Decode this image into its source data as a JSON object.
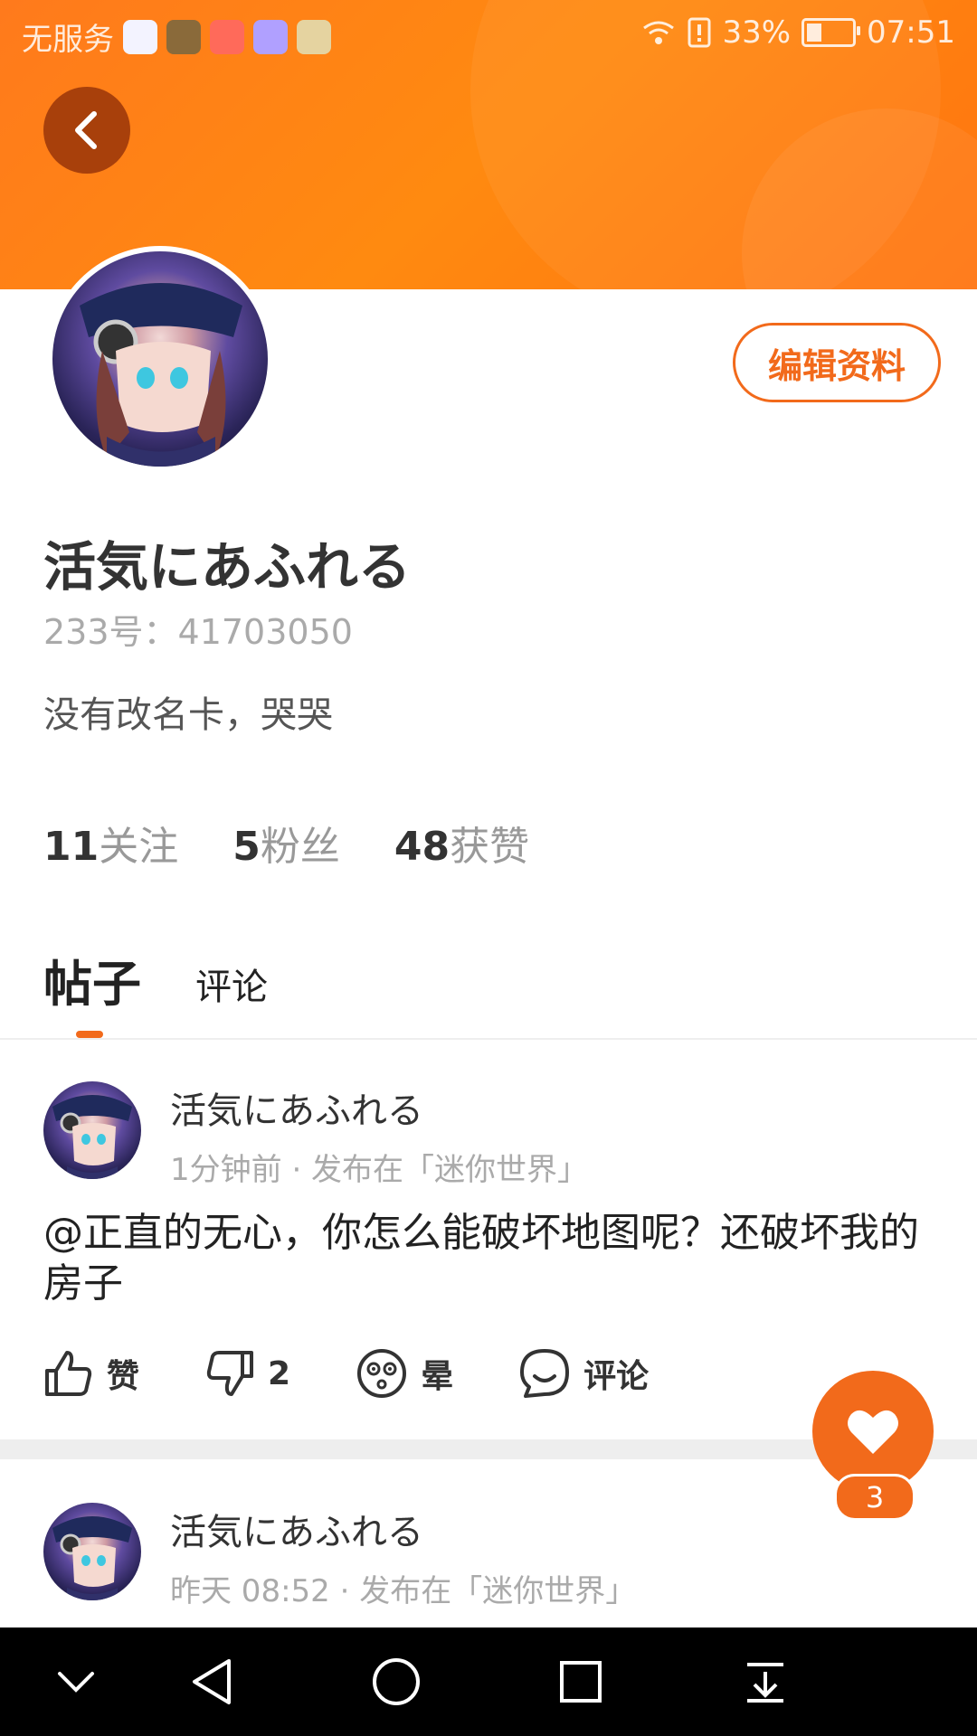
{
  "status_bar": {
    "carrier": "无服务",
    "battery": "33%",
    "time": "07:51",
    "app_icons": [
      "baidu-icon",
      "game-icon",
      "app-icon",
      "music-icon",
      "book-icon"
    ]
  },
  "colors": {
    "accent": "#f26a1b",
    "header": "#ff7f14",
    "back_button_bg": "#a8400b"
  },
  "profile": {
    "name": "活気にあふれる",
    "uid": "233号：41703050",
    "bio": "没有改名卡，哭哭",
    "edit_label": "编辑资料",
    "stats": [
      {
        "num": "11",
        "label": "关注"
      },
      {
        "num": "5",
        "label": "粉丝"
      },
      {
        "num": "48",
        "label": "获赞"
      }
    ]
  },
  "tabs": {
    "active": "帖子",
    "other": "评论"
  },
  "posts": [
    {
      "author": "活気にあふれる",
      "time": "1分钟前 · 发布在「迷你世界」",
      "text": "@正直的无心，你怎么能破坏地图呢？还破坏我的房子",
      "actions": {
        "like": "赞",
        "dislike": "2",
        "dizzy": "晕",
        "comment": "评论"
      }
    },
    {
      "author": "活気にあふれる",
      "time": "昨天 08:52 · 发布在「迷你世界」"
    }
  ],
  "fab": {
    "badge": "3"
  }
}
